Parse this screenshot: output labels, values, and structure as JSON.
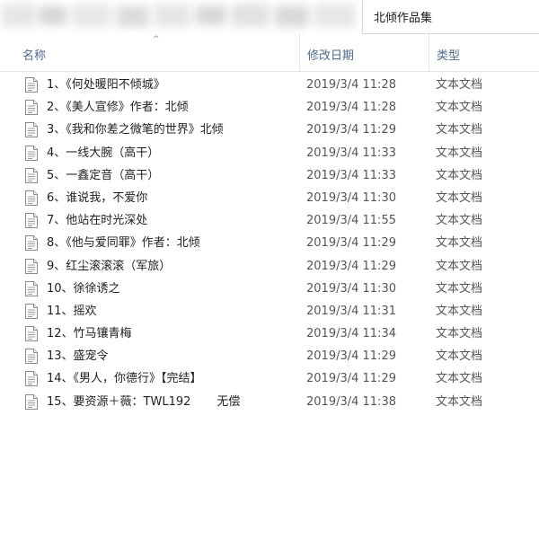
{
  "window": {
    "path_title": "北倾作品集"
  },
  "columns": {
    "name": "名称",
    "date": "修改日期",
    "type": "类型",
    "sort_indicator": "^"
  },
  "files": [
    {
      "name": "1、《何处暖阳不倾城》",
      "date": "2019/3/4 11:28",
      "type": "文本文档"
    },
    {
      "name": "2、《美人宣修》作者：北倾",
      "date": "2019/3/4 11:28",
      "type": "文本文档"
    },
    {
      "name": "3、《我和你差之微笔的世界》北倾",
      "date": "2019/3/4 11:29",
      "type": "文本文档"
    },
    {
      "name": "4、一线大腕（高干）",
      "date": "2019/3/4 11:33",
      "type": "文本文档"
    },
    {
      "name": "5、一鑫定音（高干）",
      "date": "2019/3/4 11:33",
      "type": "文本文档"
    },
    {
      "name": "6、谁说我，不爱你",
      "date": "2019/3/4 11:30",
      "type": "文本文档"
    },
    {
      "name": "7、他站在时光深处",
      "date": "2019/3/4 11:55",
      "type": "文本文档"
    },
    {
      "name": "8、《他与爱同罪》作者：北倾",
      "date": "2019/3/4 11:29",
      "type": "文本文档"
    },
    {
      "name": "9、红尘滚滚滚（军旅）",
      "date": "2019/3/4 11:29",
      "type": "文本文档"
    },
    {
      "name": "10、徐徐诱之",
      "date": "2019/3/4 11:30",
      "type": "文本文档"
    },
    {
      "name": "11、摇欢",
      "date": "2019/3/4 11:31",
      "type": "文本文档"
    },
    {
      "name": "12、竹马镶青梅",
      "date": "2019/3/4 11:34",
      "type": "文本文档"
    },
    {
      "name": "13、盛宠令",
      "date": "2019/3/4 11:29",
      "type": "文本文档"
    },
    {
      "name": "14、《男人，你德行》【完结】",
      "date": "2019/3/4 11:29",
      "type": "文本文档"
    },
    {
      "name": "15、要资源＋薇：TWL192       无偿",
      "date": "2019/3/4 11:38",
      "type": "文本文档"
    }
  ]
}
